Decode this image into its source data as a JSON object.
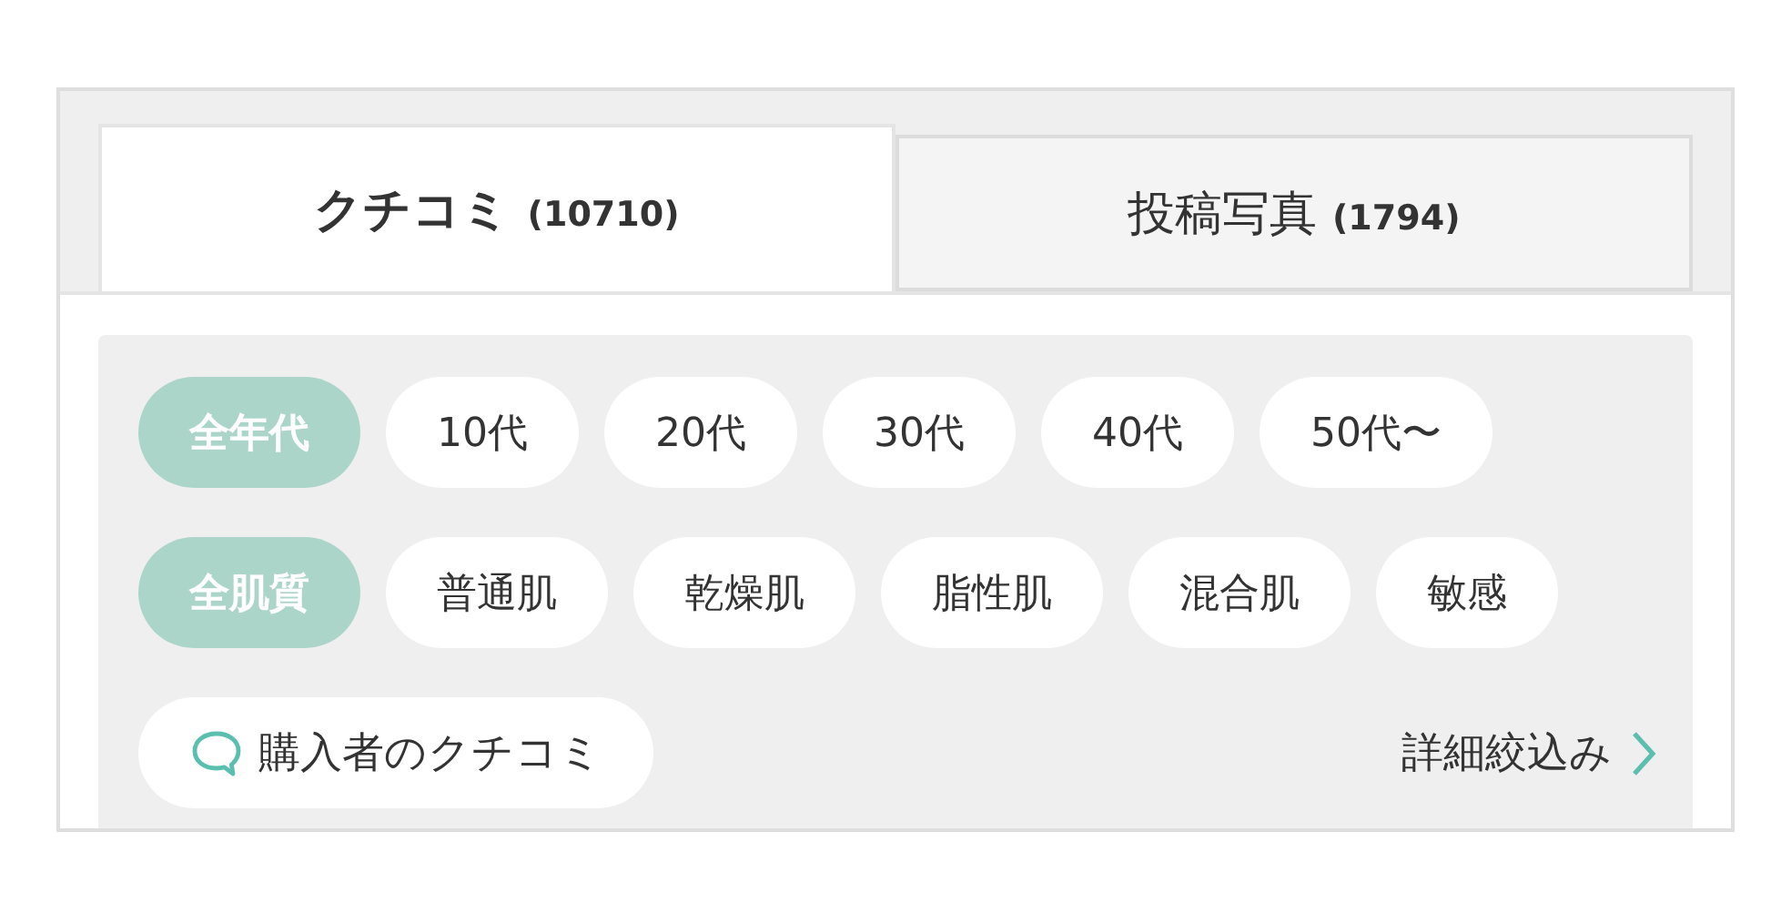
{
  "tabs": [
    {
      "label": "クチコミ",
      "count": "(10710)",
      "selected": true
    },
    {
      "label": "投稿写真",
      "count": "(1794)",
      "selected": false
    }
  ],
  "age_filters": [
    {
      "label": "全年代",
      "selected": true
    },
    {
      "label": "10代",
      "selected": false
    },
    {
      "label": "20代",
      "selected": false
    },
    {
      "label": "30代",
      "selected": false
    },
    {
      "label": "40代",
      "selected": false
    },
    {
      "label": "50代〜",
      "selected": false
    }
  ],
  "skin_filters": [
    {
      "label": "全肌質",
      "selected": true
    },
    {
      "label": "普通肌",
      "selected": false
    },
    {
      "label": "乾燥肌",
      "selected": false
    },
    {
      "label": "脂性肌",
      "selected": false
    },
    {
      "label": "混合肌",
      "selected": false
    },
    {
      "label": "敏感",
      "selected": false
    }
  ],
  "buyer_reviews_button": {
    "label": "購入者のクチコミ"
  },
  "detail_filter_link": {
    "label": "詳細絞込み"
  }
}
